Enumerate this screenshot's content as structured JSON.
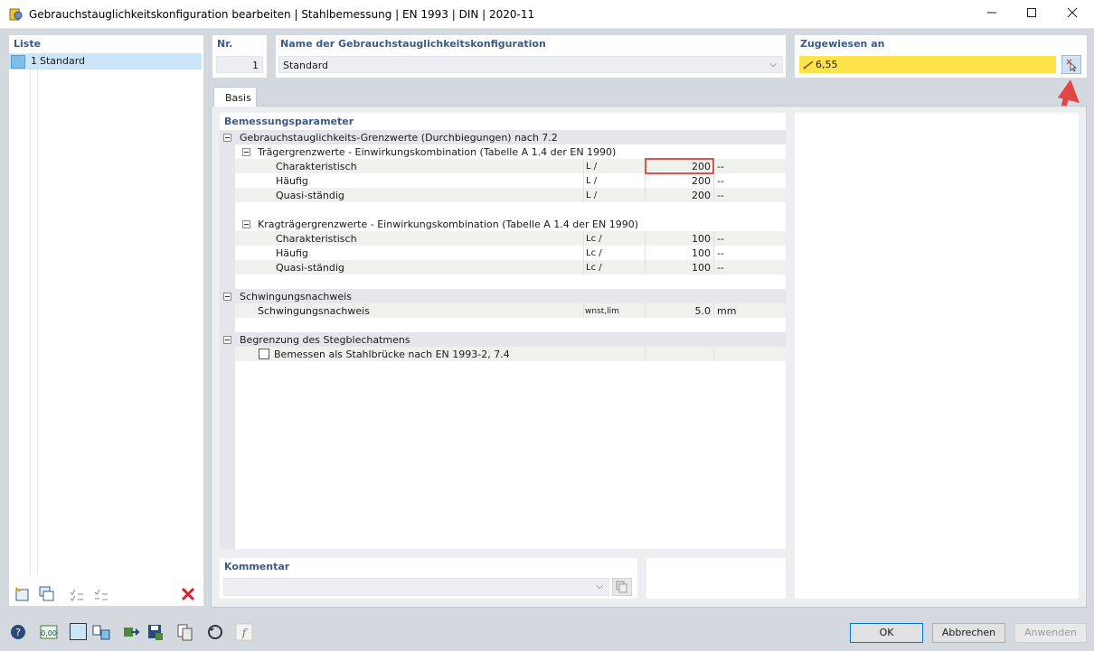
{
  "window": {
    "title": "Gebrauchstauglichkeitskonfiguration bearbeiten | Stahlbemessung | EN 1993 | DIN | 2020-11",
    "minimize_icon": "minimize-icon",
    "maximize_icon": "maximize-icon",
    "close_icon": "close-icon"
  },
  "list": {
    "title": "Liste",
    "items": [
      {
        "number": "1",
        "label": "Standard",
        "color": "#7ec0ec"
      }
    ]
  },
  "header": {
    "nr_label": "Nr.",
    "nr_value": "1",
    "name_label": "Name der Gebrauchstauglichkeitskonfiguration",
    "name_value": "Standard",
    "assigned_label": "Zugewiesen an",
    "assigned_value": "6,55",
    "assigned_color": "#fee44a"
  },
  "tabs": [
    {
      "label": "Basis"
    }
  ],
  "params": {
    "title": "Bemessungsparameter",
    "groups": [
      {
        "label": "Gebrauchstauglichkeits-Grenzwerte (Durchbiegungen) nach 7.2",
        "subgroups": [
          {
            "label": "Trägergrenzwerte - Einwirkungskombination (Tabelle A 1.4 der EN 1990)",
            "rows": [
              {
                "label": "Charakteristisch",
                "symbol": "L /",
                "value": "200",
                "unit": "--"
              },
              {
                "label": "Häufig",
                "symbol": "L /",
                "value": "200",
                "unit": "--"
              },
              {
                "label": "Quasi-ständig",
                "symbol": "L /",
                "value": "200",
                "unit": "--"
              }
            ]
          },
          {
            "label": "Kragträgergrenzwerte - Einwirkungskombination (Tabelle A 1.4 der EN 1990)",
            "rows": [
              {
                "label": "Charakteristisch",
                "symbol": "Lc /",
                "value": "100",
                "unit": "--"
              },
              {
                "label": "Häufig",
                "symbol": "Lc /",
                "value": "100",
                "unit": "--"
              },
              {
                "label": "Quasi-ständig",
                "symbol": "Lc /",
                "value": "100",
                "unit": "--"
              }
            ]
          }
        ]
      },
      {
        "label": "Schwingungsnachweis",
        "rows": [
          {
            "label": "Schwingungsnachweis",
            "symbol": "wnst,lim",
            "value": "5.0",
            "unit": "mm"
          }
        ]
      },
      {
        "label": "Begrenzung des Stegblechatmens",
        "rows": [
          {
            "label": "Bemessen als Stahlbrücke nach EN 1993-2, 7.4",
            "checked": false
          }
        ]
      }
    ]
  },
  "comment": {
    "label": "Kommentar",
    "value": ""
  },
  "buttons": {
    "ok": "OK",
    "cancel": "Abbrechen",
    "apply": "Anwenden"
  },
  "colors": {
    "accent": "#3c5a86",
    "highlight": "#d9534f",
    "selection": "#cce4f7"
  }
}
